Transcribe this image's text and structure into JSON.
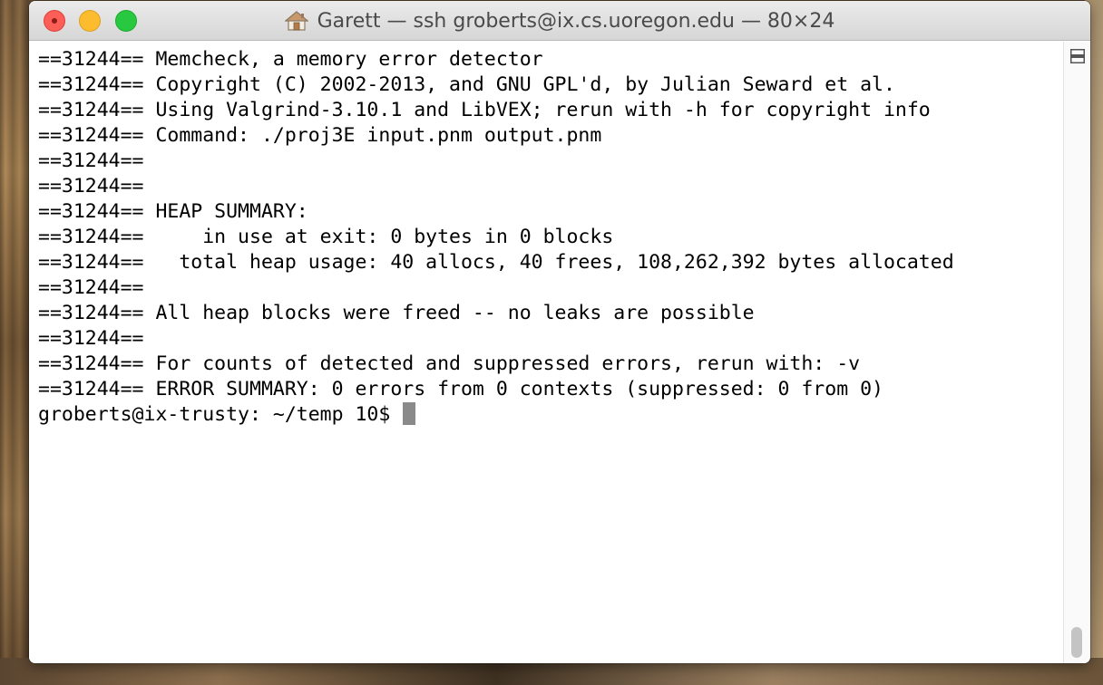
{
  "window": {
    "title": "Garett — ssh groberts@ix.cs.uoregon.edu — 80×24"
  },
  "terminal": {
    "lines": [
      "==31244== Memcheck, a memory error detector",
      "==31244== Copyright (C) 2002-2013, and GNU GPL'd, by Julian Seward et al.",
      "==31244== Using Valgrind-3.10.1 and LibVEX; rerun with -h for copyright info",
      "==31244== Command: ./proj3E input.pnm output.pnm",
      "==31244==",
      "==31244==",
      "==31244== HEAP SUMMARY:",
      "==31244==     in use at exit: 0 bytes in 0 blocks",
      "==31244==   total heap usage: 40 allocs, 40 frees, 108,262,392 bytes allocated",
      "==31244==",
      "==31244== All heap blocks were freed -- no leaks are possible",
      "==31244==",
      "==31244== For counts of detected and suppressed errors, rerun with: -v",
      "==31244== ERROR SUMMARY: 0 errors from 0 contexts (suppressed: 0 from 0)"
    ],
    "prompt": "groberts@ix-trusty: ~/temp 10$ "
  },
  "icons": {
    "close": "close-button",
    "minimize": "minimize-button",
    "maximize": "zoom-button",
    "home": "home-icon",
    "split": "split-pane-icon"
  },
  "colors": {
    "close": "#fc5f57",
    "minimize": "#fdbc2e",
    "maximize": "#28c940",
    "cursor": "#8a8a8a"
  }
}
